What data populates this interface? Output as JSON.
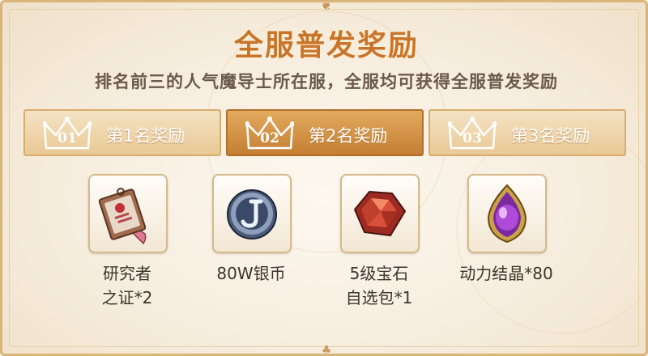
{
  "title": "全服普发奖励",
  "subtitle": "排名前三的人气魔导士所在服，全服均可获得全服普发奖励",
  "tabs": [
    {
      "num": "01",
      "label": "第1名奖励",
      "active": false
    },
    {
      "num": "02",
      "label": "第2名奖励",
      "active": true
    },
    {
      "num": "03",
      "label": "第3名奖励",
      "active": false
    }
  ],
  "rewards": [
    {
      "icon": "researcher-badge-icon",
      "name_line1": "研究者",
      "name_line2": "之证*2"
    },
    {
      "icon": "silver-coin-icon",
      "name_line1": "80W银币",
      "name_line2": ""
    },
    {
      "icon": "red-gem-icon",
      "name_line1": "5级宝石",
      "name_line2": "自选包*1"
    },
    {
      "icon": "power-crystal-icon",
      "name_line1": "动力结晶*80",
      "name_line2": ""
    }
  ],
  "colors": {
    "title": "#c9742b",
    "tab_active": "#c47f34",
    "tab_inactive": "#e9c995",
    "border": "#d9b57a"
  }
}
